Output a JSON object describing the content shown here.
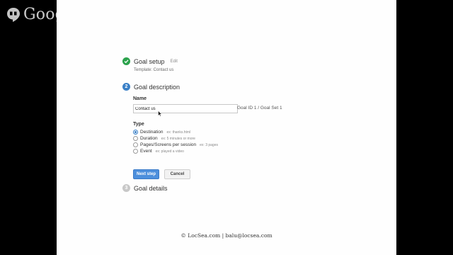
{
  "brand": {
    "text": "Google+"
  },
  "steps": [
    {
      "number": "",
      "title": "Goal setup",
      "edit": "Edit",
      "subtitle": "Template: Contact us",
      "status": "done",
      "icon": "check-icon"
    },
    {
      "number": "2",
      "title": "Goal description",
      "status": "active"
    },
    {
      "number": "3",
      "title": "Goal details",
      "status": "pending"
    }
  ],
  "form": {
    "name_label": "Name",
    "name_value": "Contact us",
    "goal_id": "Goal ID 1 / Goal Set 1",
    "type_label": "Type",
    "options": [
      {
        "label": "Destination",
        "example": "ex: thanks.html",
        "selected": true
      },
      {
        "label": "Duration",
        "example": "ex: 5 minutes or more",
        "selected": false
      },
      {
        "label": "Pages/Screens per session",
        "example": "ex: 3 pages",
        "selected": false
      },
      {
        "label": "Event",
        "example": "ex: played a video",
        "selected": false
      }
    ],
    "next_label": "Next step",
    "cancel_label": "Cancel"
  },
  "footer": {
    "text": "© LocSea.com  |  balu@locsea.com"
  },
  "colors": {
    "done": "#2ba24c",
    "active": "#3a80c7",
    "pending": "#c8c8c8",
    "primary_button": "#4d8fdc"
  }
}
